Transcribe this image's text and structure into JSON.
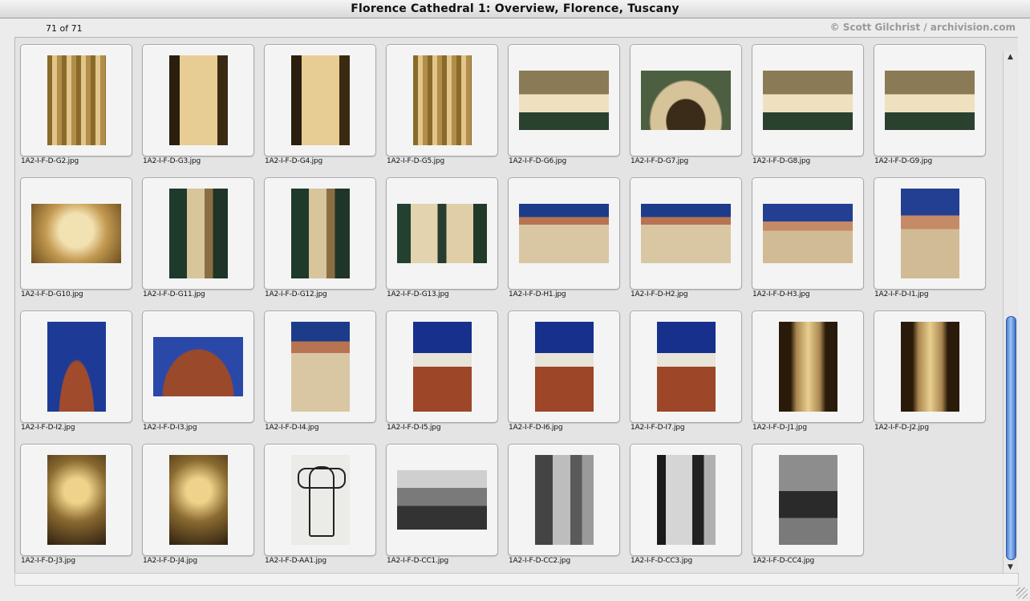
{
  "window": {
    "title": "Florence Cathedral 1: Overview, Florence, Tuscany"
  },
  "toolbar": {
    "count": "71 of 71",
    "credit": "© Scott Gilchrist / archivision.com"
  },
  "files": [
    "1A2-I-F-D-G2.jpg",
    "1A2-I-F-D-G3.jpg",
    "1A2-I-F-D-G4.jpg",
    "1A2-I-F-D-G5.jpg",
    "1A2-I-F-D-G6.jpg",
    "1A2-I-F-D-G7.jpg",
    "1A2-I-F-D-G8.jpg",
    "1A2-I-F-D-G9.jpg",
    "1A2-I-F-D-G10.jpg",
    "1A2-I-F-D-G11.jpg",
    "1A2-I-F-D-G12.jpg",
    "1A2-I-F-D-G13.jpg",
    "1A2-I-F-D-H1.jpg",
    "1A2-I-F-D-H2.jpg",
    "1A2-I-F-D-H3.jpg",
    "1A2-I-F-D-I1.jpg",
    "1A2-I-F-D-I2.jpg",
    "1A2-I-F-D-I3.jpg",
    "1A2-I-F-D-I4.jpg",
    "1A2-I-F-D-I5.jpg",
    "1A2-I-F-D-I6.jpg",
    "1A2-I-F-D-I7.jpg",
    "1A2-I-F-D-J1.jpg",
    "1A2-I-F-D-J2.jpg",
    "1A2-I-F-D-J3.jpg",
    "1A2-I-F-D-J4.jpg",
    "1A2-I-F-D-AA1.jpg",
    "1A2-I-F-D-CC1.jpg",
    "1A2-I-F-D-CC2.jpg",
    "1A2-I-F-D-CC3.jpg",
    "1A2-I-F-D-CC4.jpg"
  ],
  "scrollbar": {
    "position": 0.95,
    "up_icon": "arrow-up-icon",
    "down_icon": "arrow-down-icon"
  }
}
